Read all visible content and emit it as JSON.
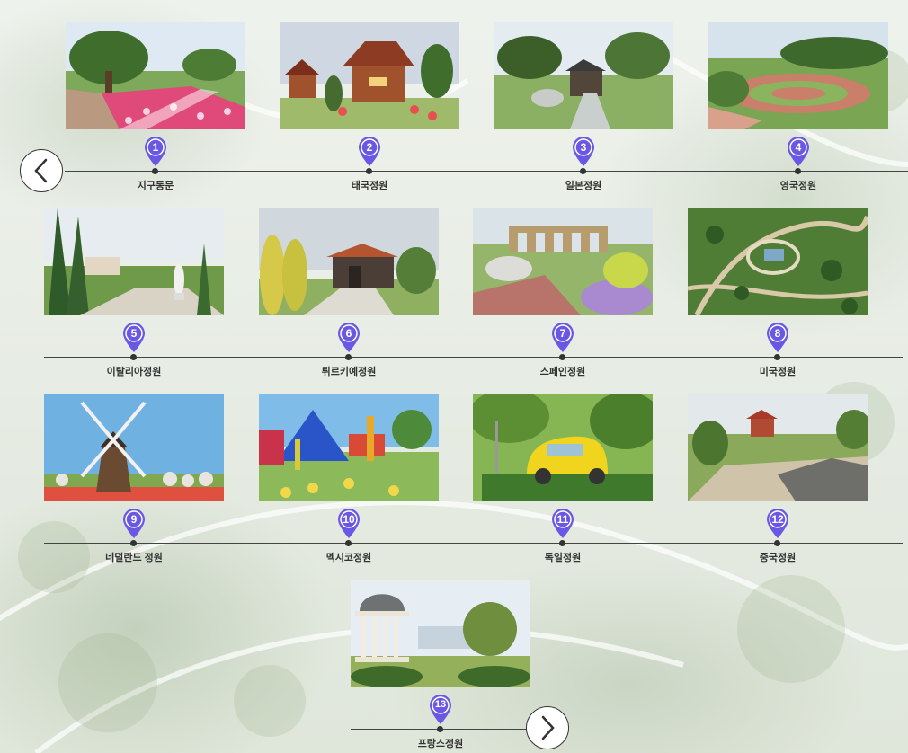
{
  "nav": {
    "prev_icon": "chevron-left-icon",
    "next_icon": "chevron-right-icon"
  },
  "gardens": [
    {
      "num": "1",
      "label": "지구동문"
    },
    {
      "num": "2",
      "label": "태국정원"
    },
    {
      "num": "3",
      "label": "일본정원"
    },
    {
      "num": "4",
      "label": "영국정원"
    },
    {
      "num": "5",
      "label": "이탈리아정원"
    },
    {
      "num": "6",
      "label": "튀르키예정원"
    },
    {
      "num": "7",
      "label": "스페인정원"
    },
    {
      "num": "8",
      "label": "미국정원"
    },
    {
      "num": "9",
      "label": "네덜란드 정원"
    },
    {
      "num": "10",
      "label": "멕시코정원"
    },
    {
      "num": "11",
      "label": "독일정원"
    },
    {
      "num": "12",
      "label": "중국정원"
    },
    {
      "num": "13",
      "label": "프랑스정원"
    }
  ],
  "colors": {
    "pin": "#6a57e3",
    "line": "#444444"
  }
}
